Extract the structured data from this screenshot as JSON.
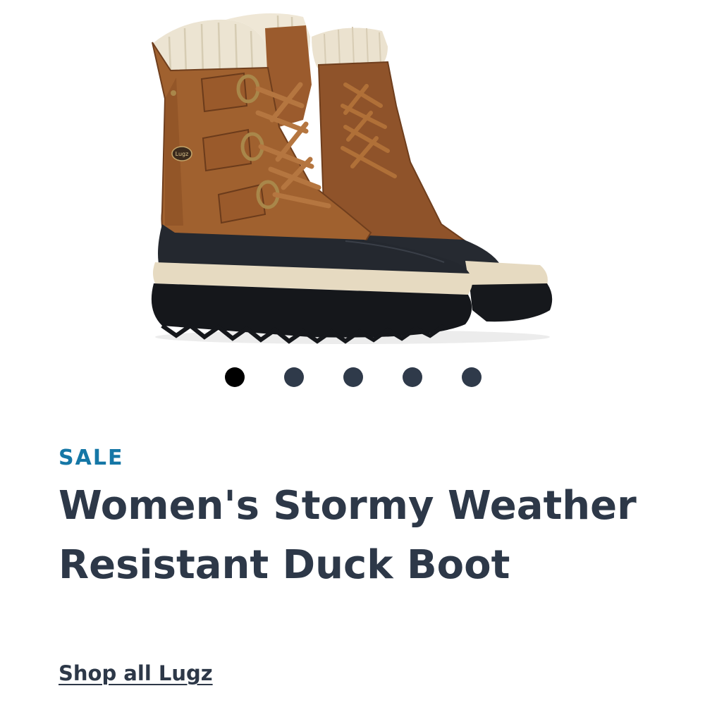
{
  "product": {
    "badge": "SALE",
    "title": "Women's Stormy Weather Resistant Duck Boot",
    "brand_link": "Shop all Lugz",
    "image_alt": "Brown and black lace-up duck boots with cream knit cuffs",
    "logo_text": "Lugz"
  },
  "carousel": {
    "total": 5,
    "active_index": 0
  },
  "colors": {
    "badge": "#1577a6",
    "title": "#2d3848",
    "dot_active": "#000000",
    "dot_inactive": "#2f3a4a",
    "leather": "#9a5a2c",
    "rubber": "#23262c",
    "cream": "#e9dfc9"
  }
}
